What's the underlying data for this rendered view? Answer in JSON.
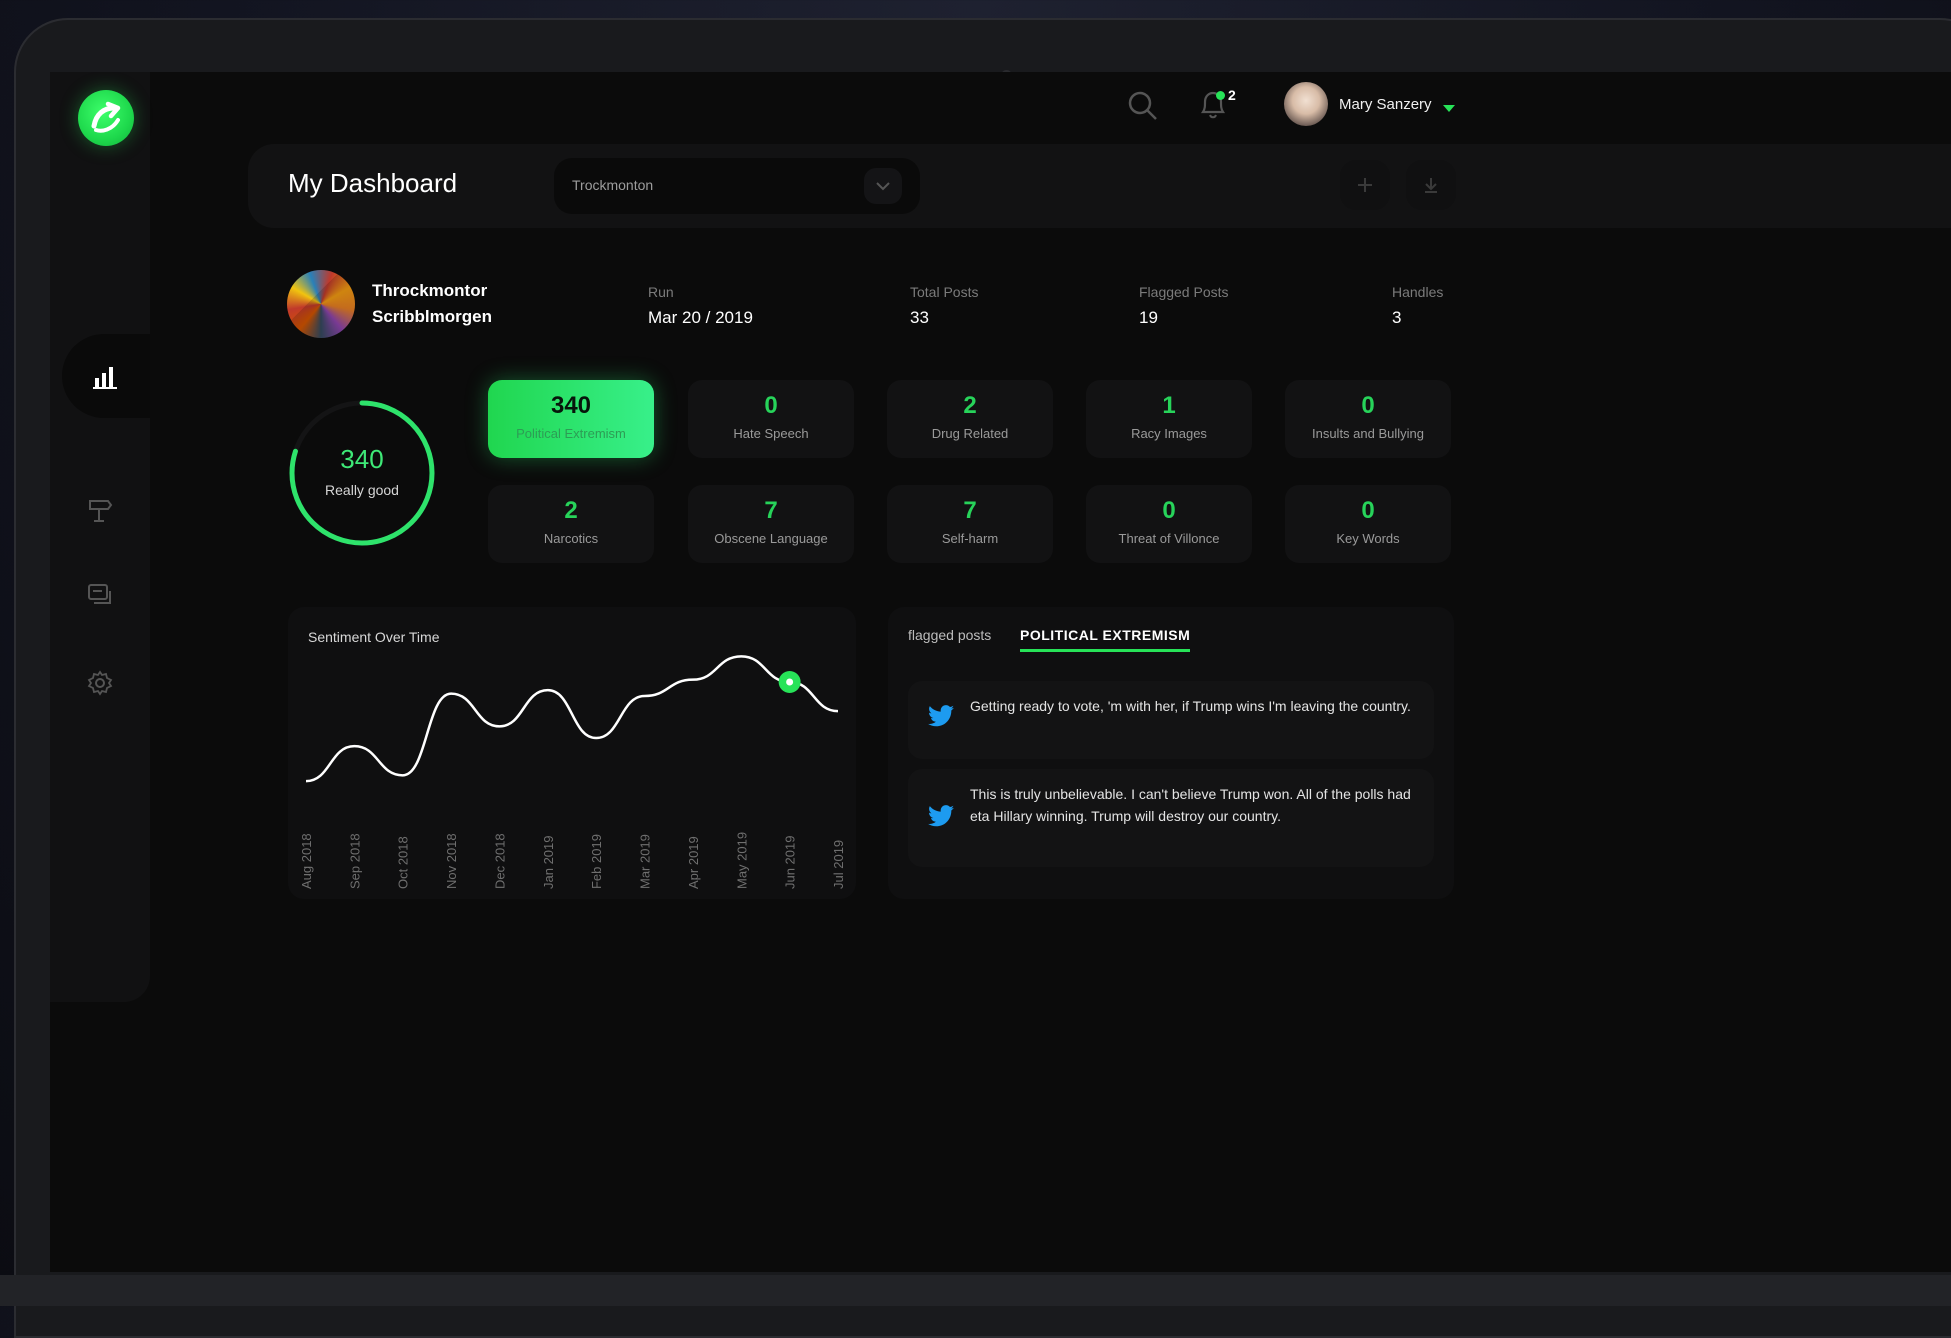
{
  "topbar": {
    "notification_count": "2",
    "user_name": "Mary Sanzery"
  },
  "header": {
    "title": "My Dashboard",
    "select_value": "Trockmonton"
  },
  "profile": {
    "first_name": "Throckmontor",
    "last_name": "Scribblmorgen",
    "stats": [
      {
        "label": "Run",
        "value": "Mar 20 / 2019"
      },
      {
        "label": "Total Posts",
        "value": "33"
      },
      {
        "label": "Flagged Posts",
        "value": "19"
      },
      {
        "label": "Handles",
        "value": "3"
      }
    ]
  },
  "score": {
    "value": "340",
    "label": "Really good",
    "ring_fraction": 0.8
  },
  "categories": [
    {
      "count": "340",
      "label": "Political Extremism",
      "active": true
    },
    {
      "count": "0",
      "label": "Hate Speech"
    },
    {
      "count": "2",
      "label": "Drug Related"
    },
    {
      "count": "1",
      "label": "Racy Images"
    },
    {
      "count": "0",
      "label": "Insults and Bullying"
    },
    {
      "count": "2",
      "label": "Narcotics"
    },
    {
      "count": "7",
      "label": "Obscene Language"
    },
    {
      "count": "7",
      "label": "Self-harm"
    },
    {
      "count": "0",
      "label": "Threat of Villonce"
    },
    {
      "count": "0",
      "label": "Key Words"
    }
  ],
  "chart_data": {
    "type": "line",
    "title": "Sentiment Over Time",
    "x": [
      "Aug 2018",
      "Sep 2018",
      "Oct 2018",
      "Nov 2018",
      "Dec 2018",
      "Jan 2019",
      "Feb 2019",
      "Mar 2019",
      "Apr 2019",
      "May 2019",
      "Jun 2019",
      "Jul 2019"
    ],
    "series": [
      {
        "values": [
          5,
          35,
          10,
          80,
          52,
          83,
          42,
          78,
          92,
          112,
          90,
          65
        ]
      }
    ],
    "highlight_index": 10,
    "line_color": "#ffffff",
    "marker_color": "#27e358"
  },
  "posts": {
    "section_label": "flagged posts",
    "active_tab": "POLITICAL EXTREMISM",
    "items": [
      {
        "text": "Getting ready to vote, 'm with her, if Trump wins I'm leaving the country."
      },
      {
        "text": "This is truly unbelievable. I can't believe Trump won. All of the polls had eta Hillary winning. Trump will destroy our country."
      }
    ]
  },
  "colors": {
    "accent": "#27e358",
    "background": "#0b0b0b",
    "card": "#121213",
    "twitter": "#1da1f2"
  }
}
